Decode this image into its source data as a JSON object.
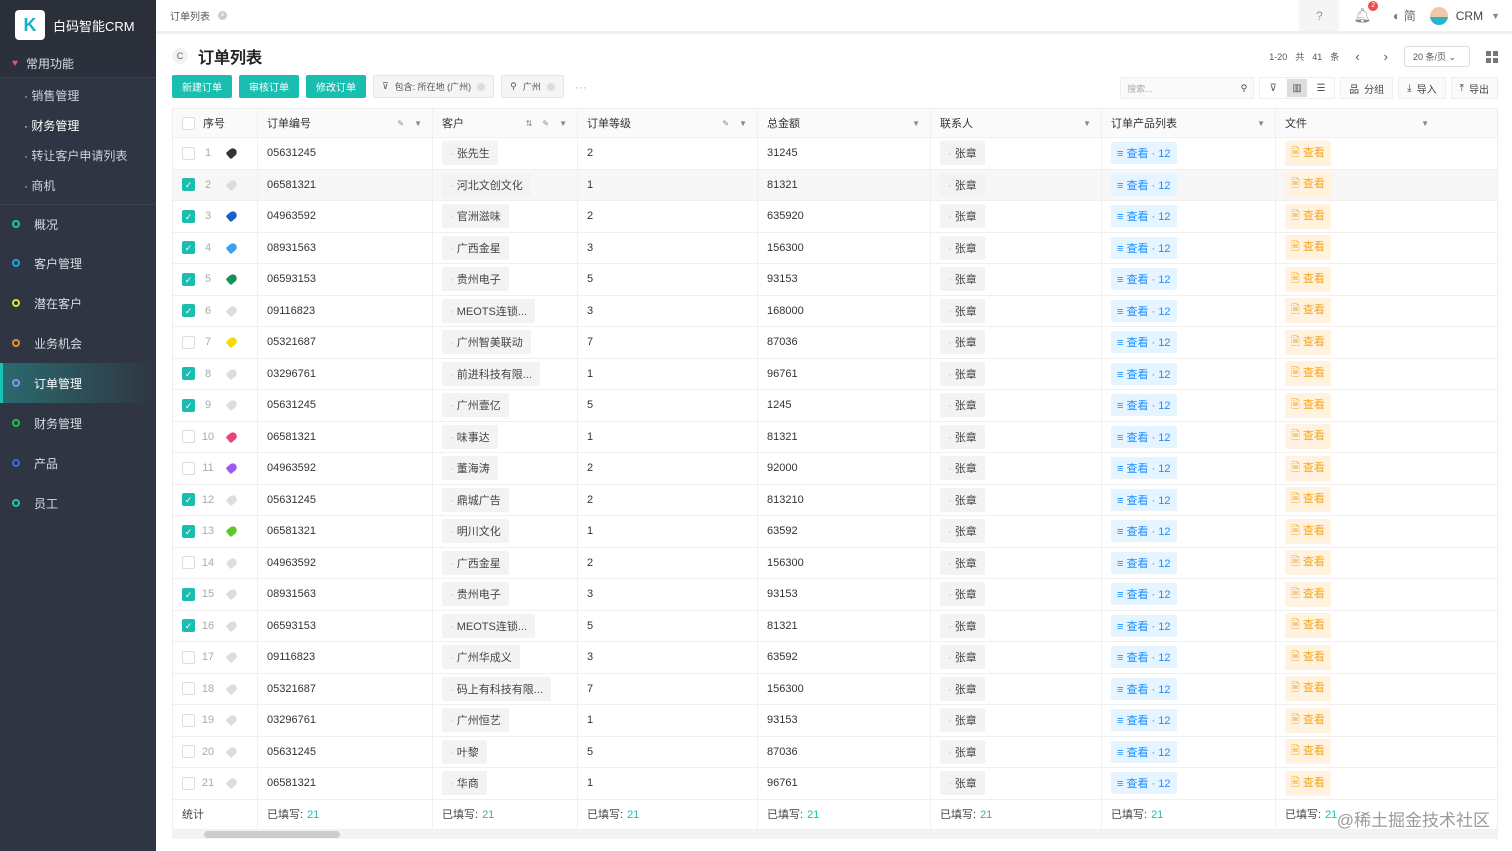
{
  "app": {
    "name": "白码智能CRM",
    "logo_letter": "K"
  },
  "sidebar": {
    "favorites": "常用功能",
    "sub_items": [
      "· 销售管理",
      "· 财务管理",
      "· 转让客户申请列表",
      "· 商机"
    ],
    "nav": [
      {
        "label": "概况",
        "color": "#1fc4b4"
      },
      {
        "label": "客户管理",
        "color": "#1ea7e8"
      },
      {
        "label": "潜在客户",
        "color": "#e6e02b"
      },
      {
        "label": "业务机会",
        "color": "#f08a30"
      },
      {
        "label": "订单管理",
        "color": "#8f8ff0",
        "active": true
      },
      {
        "label": "财务管理",
        "color": "#23c24a"
      },
      {
        "label": "产品",
        "color": "#3a6de0"
      },
      {
        "label": "员工",
        "color": "#1fc4b4"
      }
    ]
  },
  "topbar": {
    "tab": "订单列表",
    "notif_count": "2",
    "lang": "简",
    "user": "CRM"
  },
  "page": {
    "title": "订单列表",
    "refresh": "C"
  },
  "pager": {
    "range": "1-20",
    "total_prefix": "共",
    "total": "41",
    "total_suffix": "条",
    "page_size": "20 条/页"
  },
  "toolbar": {
    "new": "新建订单",
    "audit": "审核订单",
    "edit": "修改订单",
    "filter_chip": "包含: 所在地 (广州)",
    "search_chip": "广州",
    "more": "···",
    "search_placeholder": "搜索...",
    "group": "分组",
    "import": "导入",
    "export": "导出"
  },
  "columns": [
    "序号",
    "订单编号",
    "客户",
    "订单等级",
    "总金额",
    "联系人",
    "订单产品列表",
    "文件"
  ],
  "rows": [
    {
      "seq": "1",
      "checked": false,
      "tag": "#333333",
      "id": "05631245",
      "customer": "张先生",
      "level": "2",
      "amount": "31245"
    },
    {
      "seq": "2",
      "checked": true,
      "tag": "#dddddd",
      "id": "06581321",
      "customer": "河北文创文化",
      "level": "1",
      "amount": "81321"
    },
    {
      "seq": "3",
      "checked": true,
      "tag": "#1a5fc9",
      "id": "04963592",
      "customer": "官洲滋味",
      "level": "2",
      "amount": "635920"
    },
    {
      "seq": "4",
      "checked": true,
      "tag": "#3aa0f0",
      "id": "08931563",
      "customer": "广西金星",
      "level": "3",
      "amount": "156300"
    },
    {
      "seq": "5",
      "checked": true,
      "tag": "#12915a",
      "id": "06593153",
      "customer": "贵州电子",
      "level": "5",
      "amount": "93153"
    },
    {
      "seq": "6",
      "checked": true,
      "tag": "#dddddd",
      "id": "09116823",
      "customer": "MEOTS连锁...",
      "level": "3",
      "amount": "168000"
    },
    {
      "seq": "7",
      "checked": false,
      "tag": "#f5d90a",
      "id": "05321687",
      "customer": "广州智美联动",
      "level": "7",
      "amount": "87036"
    },
    {
      "seq": "8",
      "checked": true,
      "tag": "#dddddd",
      "id": "03296761",
      "customer": "前进科技有限...",
      "level": "1",
      "amount": "96761"
    },
    {
      "seq": "9",
      "checked": true,
      "tag": "#dddddd",
      "id": "05631245",
      "customer": "广州壹亿",
      "level": "5",
      "amount": "1245"
    },
    {
      "seq": "10",
      "checked": false,
      "tag": "#f0407a",
      "id": "06581321",
      "customer": "味事达",
      "level": "1",
      "amount": "81321"
    },
    {
      "seq": "11",
      "checked": false,
      "tag": "#9a5cf0",
      "id": "04963592",
      "customer": "董海涛",
      "level": "2",
      "amount": "92000"
    },
    {
      "seq": "12",
      "checked": true,
      "tag": "#dddddd",
      "id": "05631245",
      "customer": "鼎城广告",
      "level": "2",
      "amount": "813210"
    },
    {
      "seq": "13",
      "checked": true,
      "tag": "#5cc92a",
      "id": "06581321",
      "customer": "明川文化",
      "level": "1",
      "amount": "63592"
    },
    {
      "seq": "14",
      "checked": false,
      "tag": "#dddddd",
      "id": "04963592",
      "customer": "广西金星",
      "level": "2",
      "amount": "156300"
    },
    {
      "seq": "15",
      "checked": true,
      "tag": "#dddddd",
      "id": "08931563",
      "customer": "贵州电子",
      "level": "3",
      "amount": "93153"
    },
    {
      "seq": "16",
      "checked": true,
      "tag": "#dddddd",
      "id": "06593153",
      "customer": "MEOTS连锁...",
      "level": "5",
      "amount": "81321"
    },
    {
      "seq": "17",
      "checked": false,
      "tag": "#dddddd",
      "id": "09116823",
      "customer": "广州华成义",
      "level": "3",
      "amount": "63592"
    },
    {
      "seq": "18",
      "checked": false,
      "tag": "#dddddd",
      "id": "05321687",
      "customer": "码上有科技有限...",
      "level": "7",
      "amount": "156300"
    },
    {
      "seq": "19",
      "checked": false,
      "tag": "#dddddd",
      "id": "03296761",
      "customer": "广州恒艺",
      "level": "1",
      "amount": "93153"
    },
    {
      "seq": "20",
      "checked": false,
      "tag": "#dddddd",
      "id": "05631245",
      "customer": "叶黎",
      "level": "5",
      "amount": "87036"
    },
    {
      "seq": "21",
      "checked": false,
      "tag": "#dddddd",
      "id": "06581321",
      "customer": "华商",
      "level": "1",
      "amount": "96761"
    }
  ],
  "cell_defaults": {
    "contact": "张章",
    "products": "查看 · 12",
    "file": "查看"
  },
  "stats": {
    "label": "统计",
    "filled_label": "已填写:",
    "filled_value": "21"
  },
  "watermark": "@稀土掘金技术社区"
}
